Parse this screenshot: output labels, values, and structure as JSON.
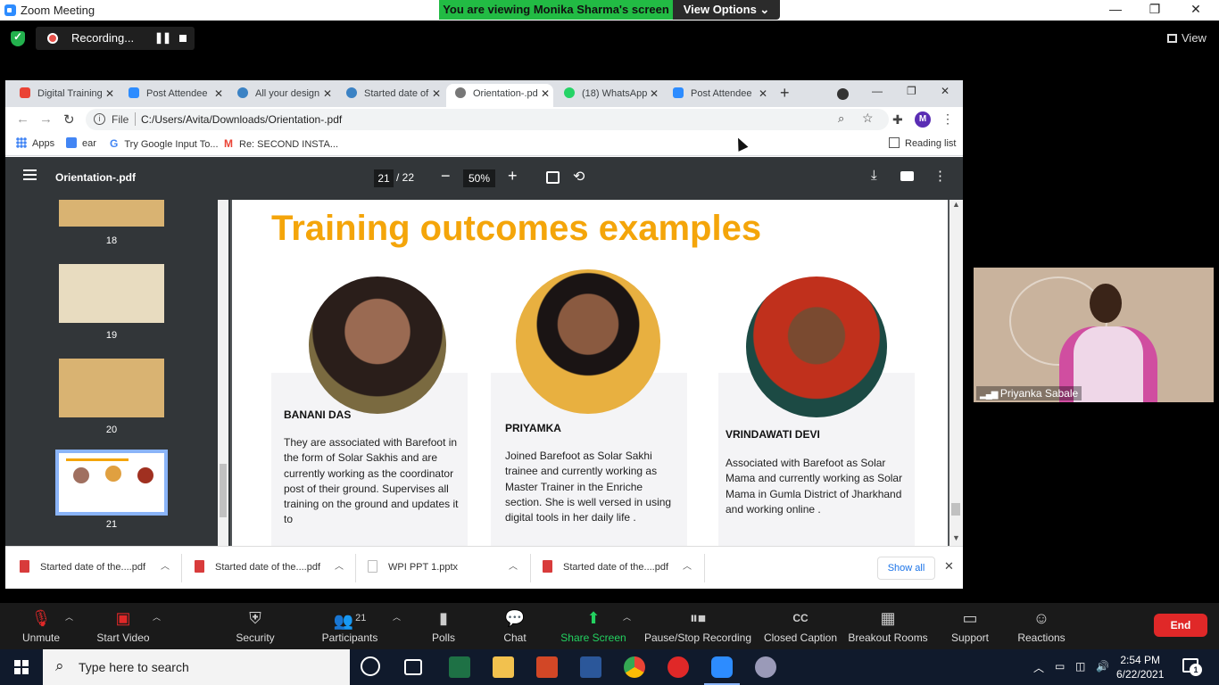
{
  "zoom": {
    "window_title": "Zoom Meeting",
    "viewing_banner": "You are viewing Monika Sharma's screen",
    "view_options": "View Options ⌄",
    "recording_label": "Recording...",
    "view_label": "View",
    "controls": {
      "unmute": "Unmute",
      "start_video": "Start Video",
      "security": "Security",
      "participants": "Participants",
      "participants_count": "21",
      "polls": "Polls",
      "chat": "Chat",
      "share_screen": "Share Screen",
      "pause_stop_recording": "Pause/Stop Recording",
      "closed_caption": "Closed Caption",
      "breakout_rooms": "Breakout Rooms",
      "support": "Support",
      "reactions": "Reactions",
      "end": "End"
    },
    "participant_video_name": "Priyanka Sabale",
    "accent_green": "#23d160",
    "end_red": "#e02828"
  },
  "browser": {
    "tabs": [
      {
        "title": "Digital Training",
        "icon": "gmail-icon",
        "color": "#ea4335",
        "active": false
      },
      {
        "title": "Post Attendee",
        "icon": "zoom-icon",
        "color": "#2d8cff",
        "active": false
      },
      {
        "title": "All your design",
        "icon": "canva-icon",
        "color": "#3b82c4",
        "active": false
      },
      {
        "title": "Started date of",
        "icon": "canva-icon",
        "color": "#3b82c4",
        "active": false
      },
      {
        "title": "Orientation-.pd",
        "icon": "globe-icon",
        "color": "#666666",
        "active": true
      },
      {
        "title": "(18) WhatsApp",
        "icon": "whatsapp-icon",
        "color": "#25d366",
        "active": false
      },
      {
        "title": "Post Attendee",
        "icon": "zoom-icon",
        "color": "#2d8cff",
        "active": false
      }
    ],
    "address_scheme": "File",
    "address_url": "C:/Users/Avita/Downloads/Orientation-.pdf",
    "profile_initial": "M",
    "bookmarks": [
      {
        "label": "Apps",
        "icon": "apps-grid-icon"
      },
      {
        "label": "ear",
        "icon": "translate-icon"
      },
      {
        "label": "Try Google Input To...",
        "icon": "google-icon"
      },
      {
        "label": "Re: SECOND INSTA...",
        "icon": "gmail-icon"
      }
    ],
    "reading_list": "Reading list",
    "downloads": [
      {
        "name": "Started date of the....pdf",
        "type": "pdf"
      },
      {
        "name": "Started date of the....pdf",
        "type": "pdf"
      },
      {
        "name": "WPI PPT 1.pptx",
        "type": "pptx"
      },
      {
        "name": "Started date of the....pdf",
        "type": "pdf"
      }
    ],
    "show_all": "Show all"
  },
  "pdf": {
    "filename": "Orientation-.pdf",
    "current_page": "21",
    "total_pages": "/ 22",
    "zoom": "50%",
    "thumbnails": [
      {
        "label": "18",
        "selected": false
      },
      {
        "label": "19",
        "selected": false
      },
      {
        "label": "20",
        "selected": false
      },
      {
        "label": "21",
        "selected": true
      }
    ],
    "slide": {
      "title": "Training outcomes examples",
      "title_color": "#f4a50a",
      "people": [
        {
          "name": "BANANI DAS",
          "description": "They are associated with Barefoot in the form of Solar Sakhis and are currently working as the coordinator post of their ground. Supervises all training on the ground and updates it to"
        },
        {
          "name": "PRIYAMKA",
          "description": "Joined Barefoot as Solar Sakhi trainee and currently working as Master Trainer in the Enriche section. She is well versed in using digital tools in her daily life ."
        },
        {
          "name": "VRINDAWATI DEVI",
          "description": "Associated with Barefoot as Solar Mama and currently working as Solar Mama in Gumla District of Jharkhand and working online ."
        }
      ]
    }
  },
  "taskbar": {
    "search_placeholder": "Type here to search",
    "time": "2:54 PM",
    "date": "6/22/2021",
    "notifications": "1"
  }
}
